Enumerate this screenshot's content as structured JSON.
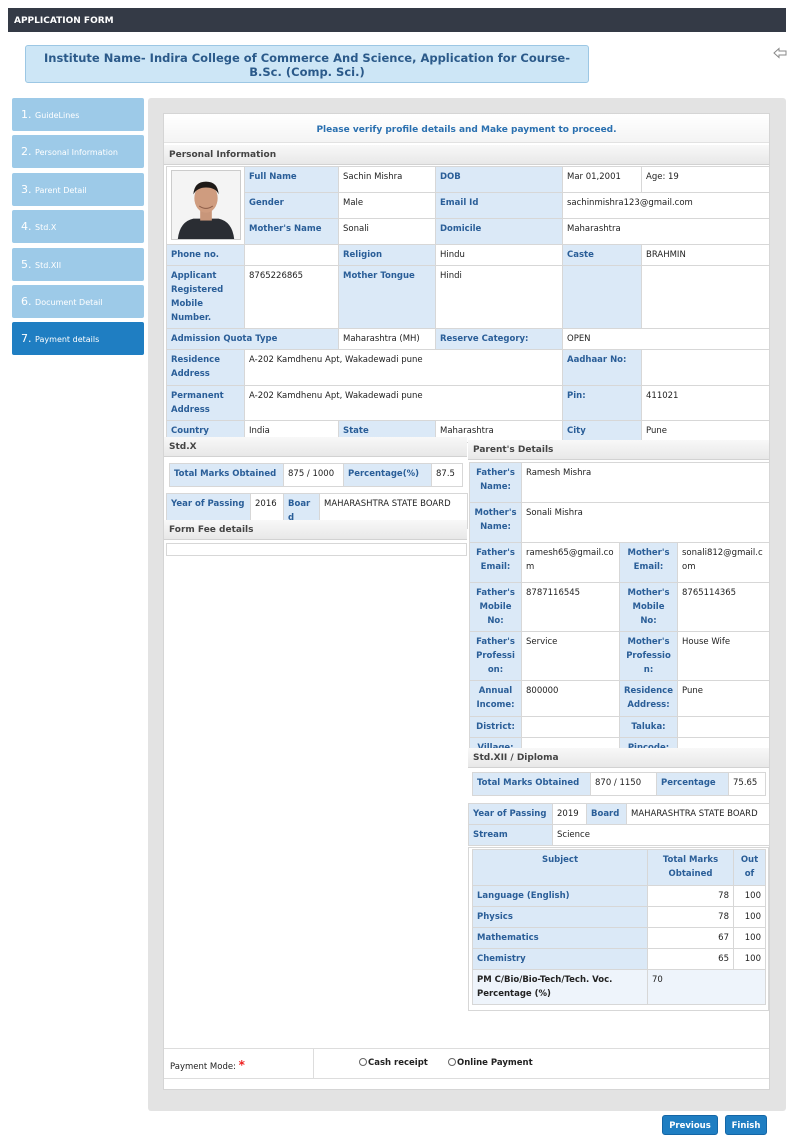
{
  "app_title": "APPLICATION FORM",
  "institute_banner": "Institute Name- Indira College of Commerce And Science, Application for Course- B.Sc. (Comp. Sci.)",
  "steps": [
    {
      "num": "1.",
      "label": "GuideLines"
    },
    {
      "num": "2.",
      "label": "Personal Information"
    },
    {
      "num": "3.",
      "label": "Parent Detail"
    },
    {
      "num": "4.",
      "label": "Std.X"
    },
    {
      "num": "5.",
      "label": "Std.XII"
    },
    {
      "num": "6.",
      "label": "Document Detail"
    },
    {
      "num": "7.",
      "label": "Payment details"
    }
  ],
  "verify_message": "Please verify profile details and Make payment to proceed.",
  "personal": {
    "heading": "Personal Information",
    "full_name_label": "Full Name",
    "full_name": "Sachin Mishra",
    "dob_label": "DOB",
    "dob": "Mar 01,2001",
    "age": "Age: 19",
    "gender_label": "Gender",
    "gender": "Male",
    "email_label": "Email Id",
    "email": "sachinmishra123@gmail.com",
    "mother_label": "Mother's Name",
    "mother": "Sonali",
    "domicile_label": "Domicile",
    "domicile": "Maharashtra",
    "phone_label": "Phone no.",
    "phone": "",
    "religion_label": "Religion",
    "religion": "Hindu",
    "caste_label": "Caste",
    "caste": "BRAHMIN",
    "mobile_label": "Applicant Registered Mobile Number.",
    "mobile": "8765226865",
    "tongue_label": "Mother Tongue",
    "tongue": "Hindi",
    "quota_label": "Admission Quota Type",
    "quota": "Maharashtra (MH)",
    "reserve_label": "Reserve Category:",
    "reserve": "OPEN",
    "res_addr_label": "Residence Address",
    "res_addr": "A-202 Kamdhenu Apt, Wakadewadi pune",
    "aadhaar_label": "Aadhaar No:",
    "aadhaar": "",
    "perm_addr_label": "Permanent Address",
    "perm_addr": "A-202 Kamdhenu Apt, Wakadewadi pune",
    "pin_label": "Pin:",
    "pin": "411021",
    "country_label": "Country",
    "country": "India",
    "state_label": "State",
    "state": "Maharashtra",
    "city_label": "City",
    "city": "Pune"
  },
  "stdx": {
    "heading": "Std.X",
    "marks_label": "Total Marks Obtained",
    "marks": "875 / 1000",
    "pct_label": "Percentage(%)",
    "pct": "87.5",
    "year_label": "Year of Passing",
    "year": "2016",
    "board_label": "Board",
    "board": "MAHARASHTRA STATE BOARD"
  },
  "fee": {
    "heading": "Form Fee details"
  },
  "parents": {
    "heading": "Parent's Details",
    "father_name_label": "Father's Name:",
    "father_name": "Ramesh Mishra",
    "mother_name_label": "Mother's Name:",
    "mother_name": "Sonali Mishra",
    "father_email_label": "Father's Email:",
    "father_email": "ramesh65@gmail.com",
    "mother_email_label": "Mother's Email:",
    "mother_email": "sonali812@gmail.com",
    "father_mobile_label": "Father's Mobile No:",
    "father_mobile": "8787116545",
    "mother_mobile_label": "Mother's Mobile No:",
    "mother_mobile": "8765114365",
    "father_prof_label": "Father's Profession:",
    "father_prof": "Service",
    "mother_prof_label": "Mother's Profession:",
    "mother_prof": "House Wife",
    "income_label": "Annual Income:",
    "income": "800000",
    "res_addr_label": "Residence Address:",
    "res_addr": "Pune",
    "district_label": "District:",
    "district": "",
    "taluka_label": "Taluka:",
    "taluka": "",
    "village_label": "Village:",
    "village": "",
    "pincode_label": "Pincode:",
    "pincode": ""
  },
  "stdxii": {
    "heading": "Std.XII / Diploma",
    "marks_label": "Total Marks Obtained",
    "marks": "870 / 1150",
    "pct_label": "Percentage",
    "pct": "75.65",
    "year_label": "Year of Passing",
    "year": "2019",
    "board_label": "Board",
    "board": "MAHARASHTRA STATE BOARD",
    "stream_label": "Stream",
    "stream": "Science",
    "col_subject": "Subject",
    "col_total": "Total Marks Obtained",
    "col_outof": "Out of",
    "subjects": [
      {
        "name": "Language (English)",
        "marks": "78",
        "outof": "100"
      },
      {
        "name": "Physics",
        "marks": "78",
        "outof": "100"
      },
      {
        "name": "Mathematics",
        "marks": "67",
        "outof": "100"
      },
      {
        "name": "Chemistry",
        "marks": "65",
        "outof": "100"
      }
    ],
    "pcm_label": "PM C/Bio/Bio-Tech/Tech. Voc. Percentage (%)",
    "pcm": "70"
  },
  "payment": {
    "label": "Payment Mode:",
    "required": "*",
    "option_cash": "Cash receipt",
    "option_online": "Online Payment"
  },
  "buttons": {
    "previous": "Previous",
    "finish": "Finish"
  }
}
